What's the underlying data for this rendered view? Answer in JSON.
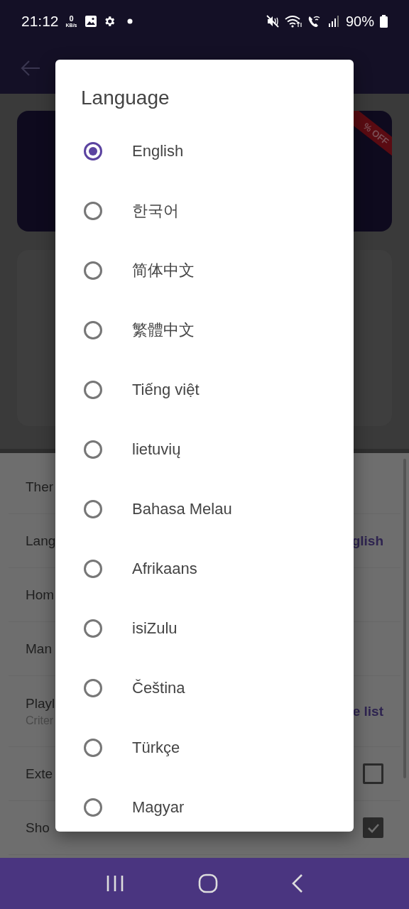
{
  "status_bar": {
    "time": "21:12",
    "net_speed": "0",
    "net_unit": "KB/s",
    "battery": "90%"
  },
  "background": {
    "promo_ribbon": "% OFF",
    "settings_rows": [
      {
        "kind": "plain",
        "label": "Ther"
      },
      {
        "kind": "value",
        "label": "Lang",
        "value": "glish"
      },
      {
        "kind": "plain",
        "label": "Hom"
      },
      {
        "kind": "plain",
        "label": "Man"
      },
      {
        "kind": "value",
        "label": "Playl",
        "sublabel": "Criter",
        "value": "e list"
      },
      {
        "kind": "checkbox",
        "label": "Exte",
        "checked": false
      },
      {
        "kind": "checkbox",
        "label": "Sho",
        "checked": true
      }
    ]
  },
  "dialog": {
    "title": "Language",
    "options": [
      {
        "label": "English",
        "selected": true
      },
      {
        "label": "한국어",
        "selected": false
      },
      {
        "label": "简体中文",
        "selected": false
      },
      {
        "label": "繁體中文",
        "selected": false
      },
      {
        "label": "Tiếng việt",
        "selected": false
      },
      {
        "label": "lietuvių",
        "selected": false
      },
      {
        "label": "Bahasa Melau",
        "selected": false
      },
      {
        "label": "Afrikaans",
        "selected": false
      },
      {
        "label": "isiZulu",
        "selected": false
      },
      {
        "label": "Čeština",
        "selected": false
      },
      {
        "label": "Türkçe",
        "selected": false
      },
      {
        "label": "Magyar",
        "selected": false
      }
    ]
  }
}
